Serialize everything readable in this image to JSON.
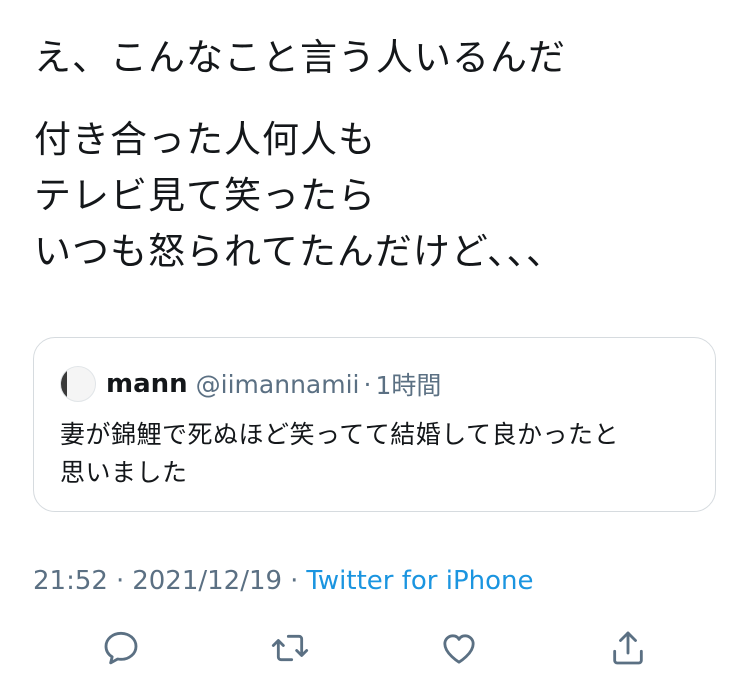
{
  "tweet": {
    "line1": "え、こんなこと言う人いるんだ",
    "line2": "付き合った人何人も",
    "line3": "テレビ見て笑ったら",
    "line4": "いつも怒られてたんだけど、、、"
  },
  "quote": {
    "name": "mann",
    "handle": "@iimannamii",
    "dot": "·",
    "time": "1時間",
    "body_line1": "妻が錦鯉で死ぬほど笑ってて結婚して良かったと",
    "body_line2": "思いました"
  },
  "meta": {
    "time": "21:52",
    "sep1": "·",
    "date": "2021/12/19",
    "sep2": "·",
    "source": "Twitter for iPhone",
    "source_color": "#1b95e0"
  },
  "actions": {
    "reply_icon": "reply-icon",
    "retweet_icon": "retweet-icon",
    "like_icon": "heart-icon",
    "share_icon": "share-icon",
    "icon_color": "#5b7083"
  }
}
